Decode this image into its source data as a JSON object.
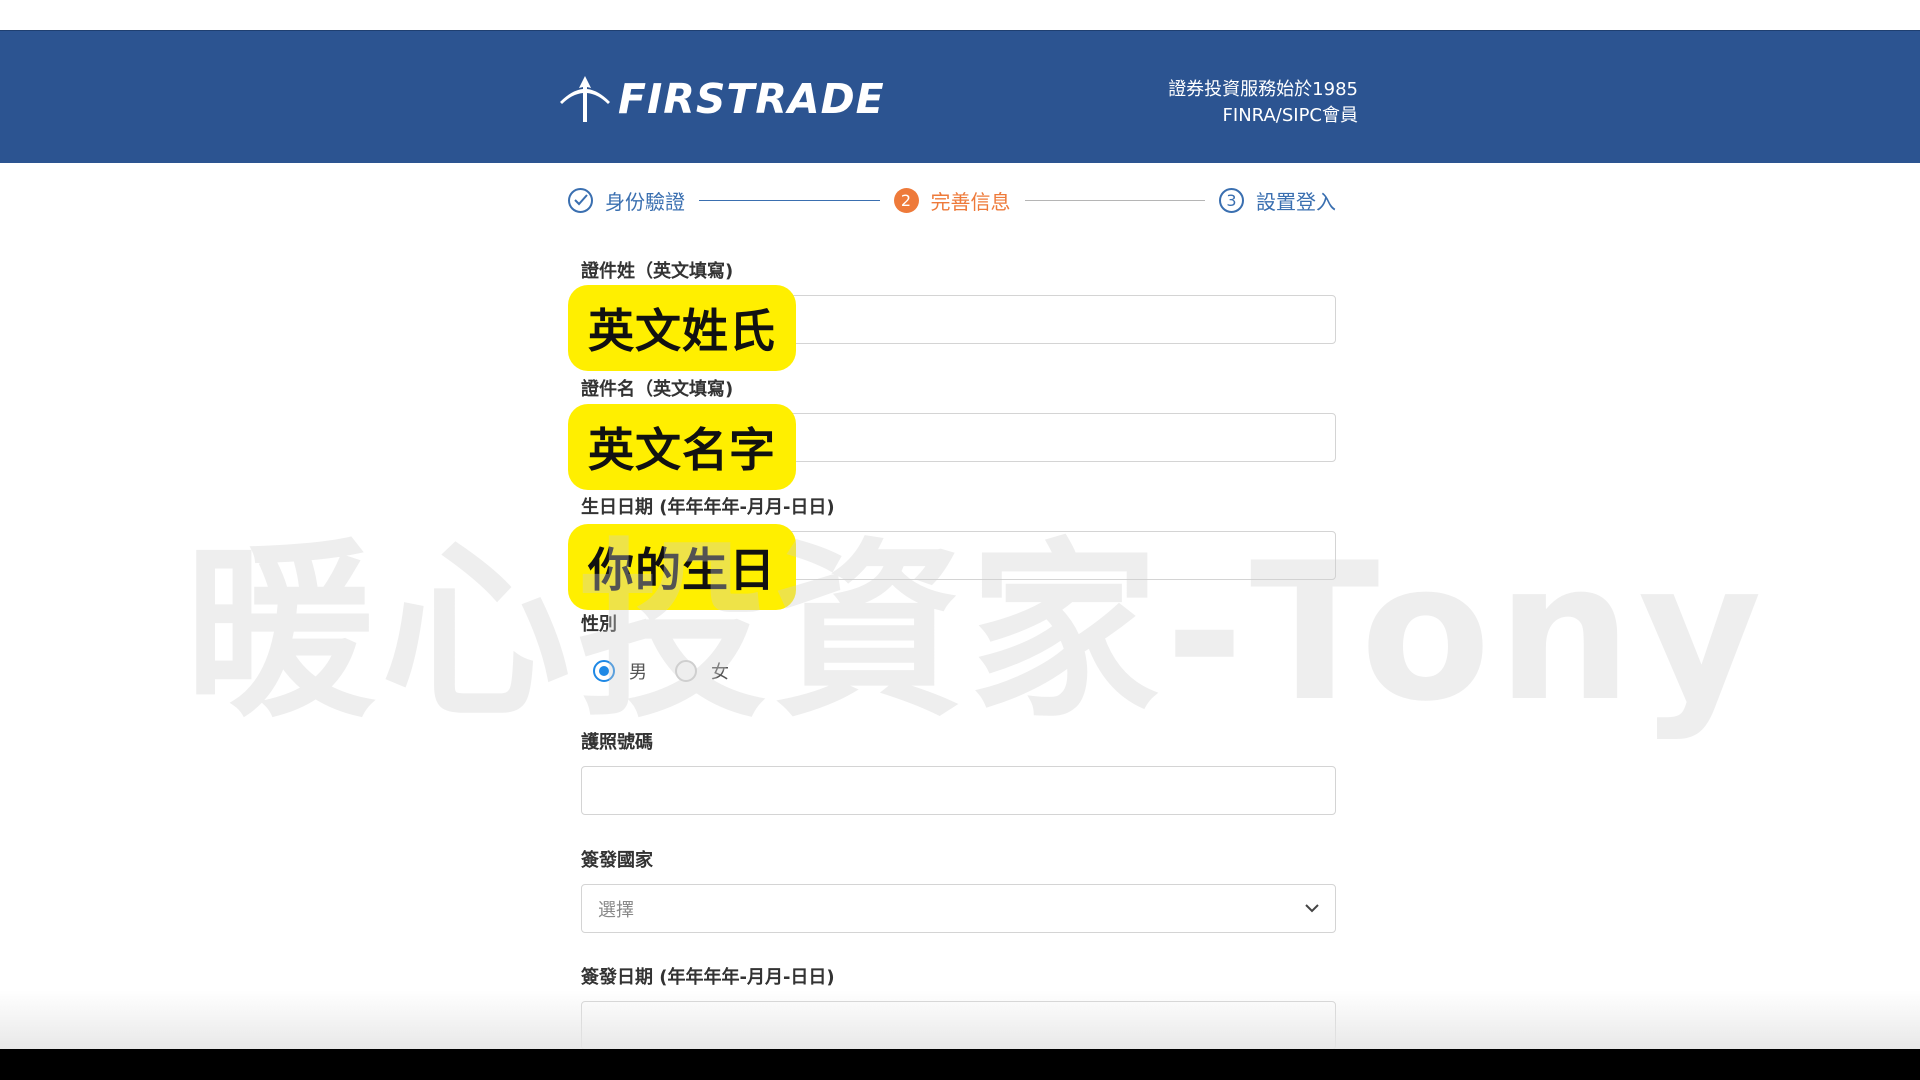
{
  "header": {
    "brand": "FIRSTRADE",
    "tagline_line1": "證券投資服務始於1985",
    "tagline_line2": "FINRA/SIPC會員",
    "brand_color": "#2c5491"
  },
  "steps": [
    {
      "number": "",
      "label": "身份驗證",
      "state": "done"
    },
    {
      "number": "2",
      "label": "完善信息",
      "state": "active"
    },
    {
      "number": "3",
      "label": "設置登入",
      "state": "todo"
    }
  ],
  "form": {
    "last_name": {
      "label": "證件姓（英文填寫)",
      "value": ""
    },
    "first_name": {
      "label": "證件名（英文填寫)",
      "value": ""
    },
    "birthdate": {
      "label": "生日日期 (年年年年-月月-日日)",
      "value": ""
    },
    "gender": {
      "label": "性別",
      "options": [
        "男",
        "女"
      ],
      "selected": "男"
    },
    "passport": {
      "label": "護照號碼",
      "value": ""
    },
    "issue_country": {
      "label": "簽發國家",
      "placeholder": "選擇"
    },
    "issue_date": {
      "label": "簽發日期 (年年年年-月月-日日)",
      "value": ""
    }
  },
  "annotations": {
    "badge_last_name": "英文姓氏",
    "badge_first_name": "英文名字",
    "badge_birthdate": "你的生日",
    "watermark": "暖心投資家-Tony",
    "badge_color": "#ffef00"
  },
  "colors": {
    "accent_orange": "#ee7a3a",
    "step_blue": "#3a6fb0",
    "radio_blue": "#1e88e5"
  }
}
